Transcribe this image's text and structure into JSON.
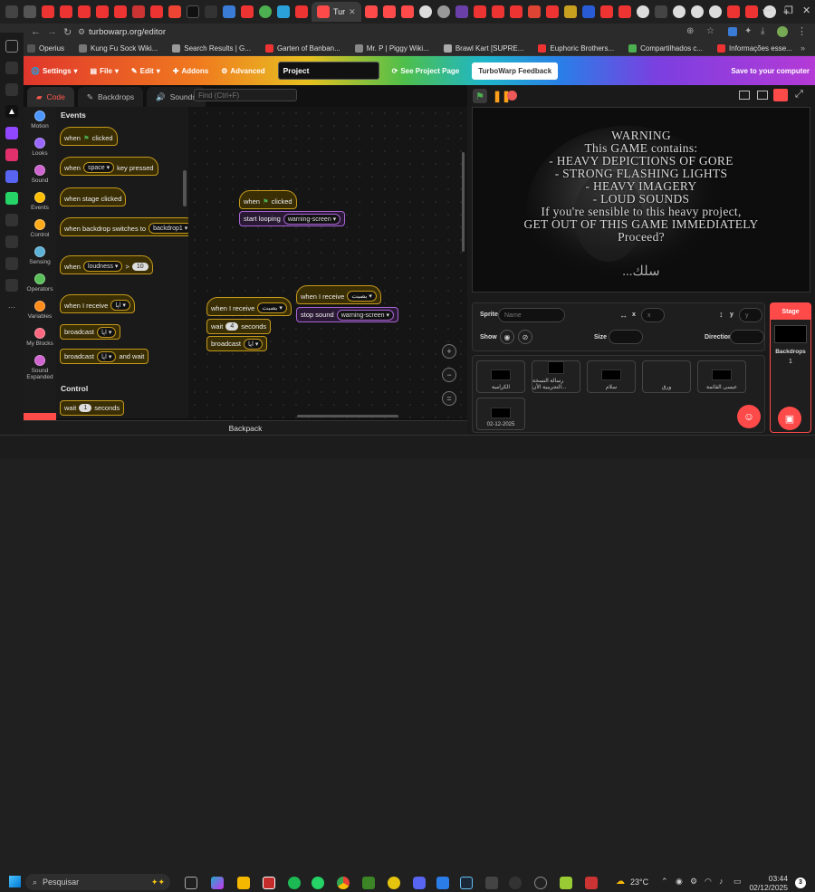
{
  "browser": {
    "active_tab_title": "Tur",
    "url": "turbowarp.org/editor",
    "bookmarks": [
      "Operius",
      "Kung Fu Sock Wiki...",
      "Search Results | G...",
      "Garten of Banban...",
      "Mr. P | Piggy Wiki...",
      "Brawl Kart [SUPRE...",
      "Euphoric Brothers...",
      "Compartilhados c...",
      "Informações esse..."
    ]
  },
  "menu": {
    "settings": "Settings",
    "file": "File",
    "edit": "Edit",
    "addons": "Addons",
    "advanced": "Advanced",
    "project_title": "Project",
    "see_project_page": "See Project Page",
    "feedback": "TurboWarp Feedback",
    "save": "Save to your computer"
  },
  "editor_tabs": {
    "code": "Code",
    "backdrops": "Backdrops",
    "sounds": "Sounds"
  },
  "find": {
    "placeholder": "Find (Ctrl+F)"
  },
  "categories": [
    {
      "label": "Motion",
      "color": "#4c97ff"
    },
    {
      "label": "Looks",
      "color": "#9966ff"
    },
    {
      "label": "Sound",
      "color": "#cf63cf"
    },
    {
      "label": "Events",
      "color": "#ffbf00"
    },
    {
      "label": "Control",
      "color": "#ffab19"
    },
    {
      "label": "Sensing",
      "color": "#5cb1d6"
    },
    {
      "label": "Operators",
      "color": "#59c059"
    },
    {
      "label": "Variables",
      "color": "#ff8c1a"
    },
    {
      "label": "My Blocks",
      "color": "#ff6680"
    },
    {
      "label": "Sound Expanded",
      "color": "#cf63cf"
    }
  ],
  "palette": {
    "events_header": "Events",
    "control_header": "Control",
    "when": "when",
    "clicked": "clicked",
    "space": "space",
    "key_pressed": "key pressed",
    "when_stage_clicked": "when stage clicked",
    "when_backdrop_switches_to": "when backdrop switches to",
    "backdrop1": "backdrop1",
    "loudness": "loudness",
    "gt": ">",
    "ten": "10",
    "when_i_receive": "when I receive",
    "msg": "اپا",
    "broadcast": "broadcast",
    "and_wait": "and wait",
    "wait": "wait",
    "one": "1",
    "seconds": "seconds"
  },
  "scripts": {
    "start_looping": "start looping",
    "warning_screen": "warning-screen",
    "receive_msg": "بصبت",
    "four": "4",
    "stop_sound": "stop sound"
  },
  "zoom": {
    "in": "+",
    "out": "−",
    "reset": "="
  },
  "backpack": "Backpack",
  "stage_warning": [
    "WARNING",
    "This GAME contains:",
    "- HEAVY DEPICTIONS OF GORE",
    "- STRONG FLASHING LIGHTS",
    "- HEAVY IMAGERY",
    "- LOUD SOUNDS",
    "If you're sensible to this heavy project,",
    "GET OUT OF THIS GAME IMMEDIATELY",
    "Proceed?"
  ],
  "stage_signature": "...سلك",
  "sprite_info": {
    "sprite_label": "Sprite",
    "name_placeholder": "Name",
    "x_label": "x",
    "x_placeholder": "x",
    "y_label": "y",
    "y_placeholder": "y",
    "show_label": "Show",
    "size_label": "Size",
    "direction_label": "Direction"
  },
  "sprites": [
    "الكرامية",
    "رسالة النسخة التجريبية الأن...",
    "سلام",
    "ورق",
    "عيسى القائمة",
    "02-12-2025"
  ],
  "stage_panel": {
    "title": "Stage",
    "backdrops_label": "Backdrops",
    "backdrops_count": "1"
  },
  "taskbar": {
    "search": "Pesquisar",
    "temperature": "23°C",
    "time": "03:44",
    "date": "02/12/2025",
    "notifications": "3"
  }
}
